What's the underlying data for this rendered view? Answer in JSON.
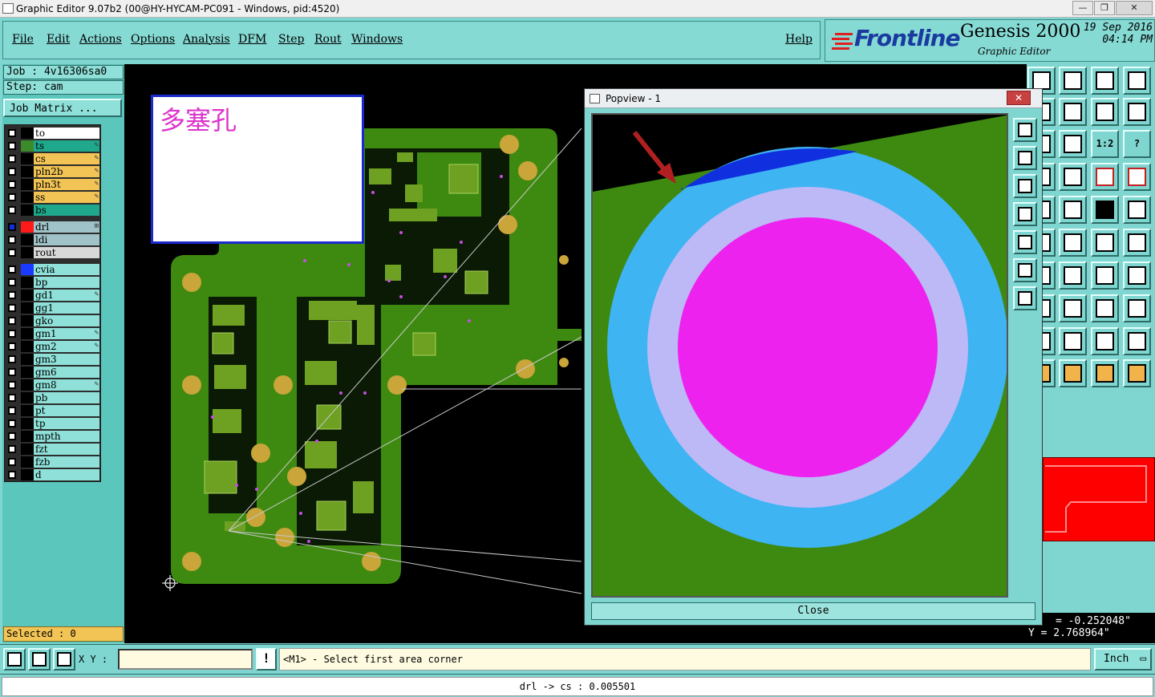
{
  "window": {
    "title": "Graphic Editor 9.07b2 (00@HY-HYCAM-PC091 - Windows, pid:4520)",
    "minimize": "—",
    "maximize": "❐",
    "close": "✕"
  },
  "menu": {
    "items": [
      "File",
      "Edit",
      "Actions",
      "Options",
      "Analysis",
      "DFM",
      "Step",
      "Rout",
      "Windows"
    ],
    "help": "Help"
  },
  "brand": {
    "logo": "Frontline",
    "product": "Genesis 2000",
    "subtitle": "Graphic Editor",
    "date": "19 Sep 2016",
    "time": "04:14 PM",
    "logo_color": "#1a3aa0"
  },
  "job": {
    "job_label": "Job : 4v16306sa0",
    "step_label": "Step: cam",
    "matrix_button": "Job Matrix ..."
  },
  "layers": [
    {
      "name": "to",
      "swatch": "#000000",
      "fill": "#ffffff",
      "mark": ""
    },
    {
      "name": "ts",
      "swatch": "#3d8a2a",
      "fill": "#1fa88c",
      "mark": "✎"
    },
    {
      "name": "cs",
      "swatch": "#000000",
      "fill": "#f2c455",
      "mark": "✎"
    },
    {
      "name": "pln2b",
      "swatch": "#000000",
      "fill": "#f2c455",
      "mark": "✎"
    },
    {
      "name": "pln3t",
      "swatch": "#000000",
      "fill": "#f2c455",
      "mark": "✎"
    },
    {
      "name": "ss",
      "swatch": "#000000",
      "fill": "#f2c455",
      "mark": "✎"
    },
    {
      "name": "bs",
      "swatch": "#000000",
      "fill": "#1fa88c",
      "mark": ""
    },
    {
      "name": "drl",
      "swatch": "#ff1a1a",
      "fill": "#9fc3c8",
      "mark": "⊞"
    },
    {
      "name": "ldi",
      "swatch": "#000000",
      "fill": "#9fc3c8",
      "mark": ""
    },
    {
      "name": "rout",
      "swatch": "#000000",
      "fill": "#d8d8d8",
      "mark": ""
    },
    {
      "name": "cvia",
      "swatch": "#1a3aff",
      "fill": "#8ee0d8",
      "mark": ""
    },
    {
      "name": "bp",
      "swatch": "#000000",
      "fill": "#8ee0d8",
      "mark": ""
    },
    {
      "name": "gd1",
      "swatch": "#000000",
      "fill": "#8ee0d8",
      "mark": "✎"
    },
    {
      "name": "gg1",
      "swatch": "#000000",
      "fill": "#8ee0d8",
      "mark": ""
    },
    {
      "name": "gko",
      "swatch": "#000000",
      "fill": "#8ee0d8",
      "mark": ""
    },
    {
      "name": "gm1",
      "swatch": "#000000",
      "fill": "#8ee0d8",
      "mark": "✎"
    },
    {
      "name": "gm2",
      "swatch": "#000000",
      "fill": "#8ee0d8",
      "mark": "✎"
    },
    {
      "name": "gm3",
      "swatch": "#000000",
      "fill": "#8ee0d8",
      "mark": ""
    },
    {
      "name": "gm6",
      "swatch": "#000000",
      "fill": "#8ee0d8",
      "mark": ""
    },
    {
      "name": "gm8",
      "swatch": "#000000",
      "fill": "#8ee0d8",
      "mark": "✎"
    },
    {
      "name": "pb",
      "swatch": "#000000",
      "fill": "#8ee0d8",
      "mark": ""
    },
    {
      "name": "pt",
      "swatch": "#000000",
      "fill": "#8ee0d8",
      "mark": ""
    },
    {
      "name": "tp",
      "swatch": "#000000",
      "fill": "#8ee0d8",
      "mark": ""
    },
    {
      "name": "mpth",
      "swatch": "#000000",
      "fill": "#8ee0d8",
      "mark": ""
    },
    {
      "name": "fzt",
      "swatch": "#000000",
      "fill": "#8ee0d8",
      "mark": ""
    },
    {
      "name": "fzb",
      "swatch": "#000000",
      "fill": "#8ee0d8",
      "mark": ""
    },
    {
      "name": "d",
      "swatch": "#000000",
      "fill": "#8ee0d8",
      "mark": ""
    }
  ],
  "selected": "Selected : 0",
  "note": {
    "text": "多塞孔"
  },
  "popview": {
    "title": "Popview - 1",
    "close_x": "✕",
    "close_button": "Close"
  },
  "coords": {
    "x": "= -0.252048\"",
    "y": "Y = 2.768964\""
  },
  "toolbar_text": {
    "b12": "1:2",
    "q": "?"
  },
  "status": {
    "xy_label": "X Y :",
    "xy_value": "",
    "warn": "!",
    "prompt": "<M1> - Select first area corner",
    "units": "Inch",
    "message": "drl -> cs : 0.005501"
  },
  "colors": {
    "board_green": "#3e8a10",
    "pad_gold": "#c9a53a",
    "ring_blue": "#3fb4f2",
    "ring_lavender": "#bdb8f6",
    "drill_magenta": "#ee22ee",
    "accent_blue": "#1030e0",
    "teal_ui": "#7fd6d0"
  }
}
